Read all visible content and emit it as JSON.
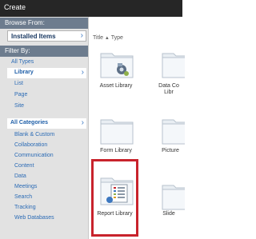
{
  "window": {
    "title": "Create"
  },
  "sidebar": {
    "browse_header": "Browse From:",
    "installed_items": "Installed Items",
    "filter_header": "Filter By:",
    "type_filters": [
      "All Types",
      "Library",
      "List",
      "Page",
      "Site"
    ],
    "selected_type": "Library",
    "category_filters": [
      "All Categories",
      "Blank & Custom",
      "Collaboration",
      "Communication",
      "Content",
      "Data",
      "Meetings",
      "Search",
      "Tracking",
      "Web Databases"
    ],
    "selected_category": "All Categories"
  },
  "main": {
    "sort": {
      "title": "Title",
      "type": "Type"
    },
    "tiles": [
      {
        "label": "Asset Library",
        "icon": "asset-library-icon"
      },
      {
        "label": "Data Co...\nLibr...",
        "icon": "data-connection-library-icon"
      },
      {
        "label": "Form Library",
        "icon": "form-library-icon"
      },
      {
        "label": "Picture",
        "icon": "picture-library-icon"
      },
      {
        "label": "Report Library",
        "icon": "report-library-icon"
      },
      {
        "label": "Slide",
        "icon": "slide-library-icon"
      }
    ]
  },
  "colors": {
    "highlight": "#c8232c",
    "sidebar_header": "#6d7c8e",
    "link": "#2b6bb5"
  }
}
